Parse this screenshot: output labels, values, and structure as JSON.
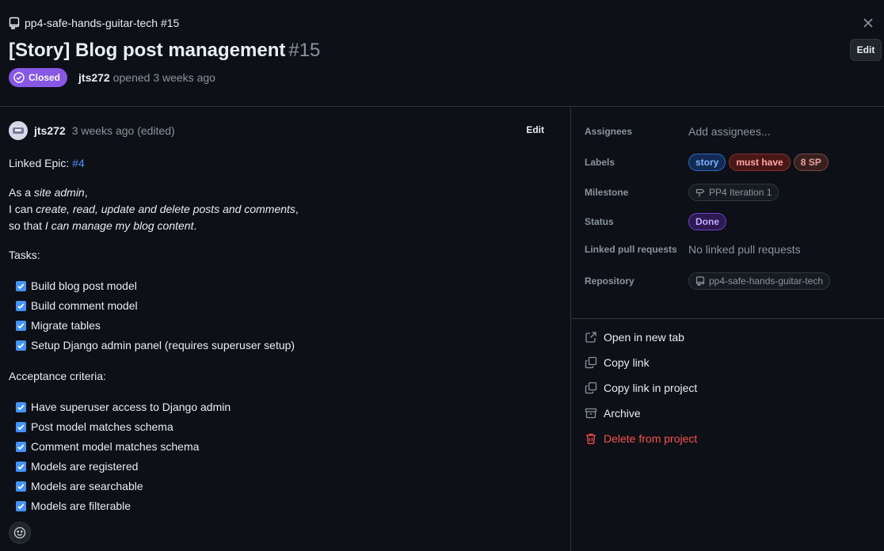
{
  "header": {
    "repo": "pp4-safe-hands-guitar-tech #15",
    "title": "[Story] Blog post management",
    "number": "#15",
    "edit_label": "Edit",
    "status": "Closed",
    "author": "jts272",
    "opened": "opened 3 weeks ago"
  },
  "comment": {
    "author": "jts272",
    "time": "3 weeks ago (edited)",
    "edit_label": "Edit",
    "epic_prefix": "Linked Epic:",
    "epic_link": "#4",
    "story": {
      "l1_a": "As a ",
      "l1_b": "site admin",
      "l1_c": ",",
      "l2_a": "I can ",
      "l2_b": "create, read, update and delete posts and comments",
      "l2_c": ",",
      "l3_a": "so that ",
      "l3_b": "I can manage my blog content",
      "l3_c": "."
    },
    "tasks_heading": "Tasks:",
    "tasks": [
      "Build blog post model",
      "Build comment model",
      "Migrate tables",
      "Setup Django admin panel (requires superuser setup)"
    ],
    "criteria_heading": "Acceptance criteria:",
    "criteria": [
      "Have superuser access to Django admin",
      "Post model matches schema",
      "Comment model matches schema",
      "Models are registered",
      "Models are searchable",
      "Models are filterable"
    ]
  },
  "sidebar": {
    "assignees": {
      "label": "Assignees",
      "value": "Add assignees..."
    },
    "labels": {
      "label": "Labels",
      "items": [
        "story",
        "must have",
        "8 SP"
      ]
    },
    "milestone": {
      "label": "Milestone",
      "value": "PP4 Iteration 1"
    },
    "status": {
      "label": "Status",
      "value": "Done"
    },
    "pull_requests": {
      "label": "Linked pull requests",
      "value": "No linked pull requests"
    },
    "repository": {
      "label": "Repository",
      "value": "pp4-safe-hands-guitar-tech"
    },
    "actions": {
      "open_new_tab": "Open in new tab",
      "copy_link": "Copy link",
      "copy_link_project": "Copy link in project",
      "archive": "Archive",
      "delete": "Delete from project"
    }
  },
  "colors": {
    "background": "#0d1117",
    "closed": "#8957e5",
    "link": "#4493f8",
    "danger": "#f85149"
  }
}
